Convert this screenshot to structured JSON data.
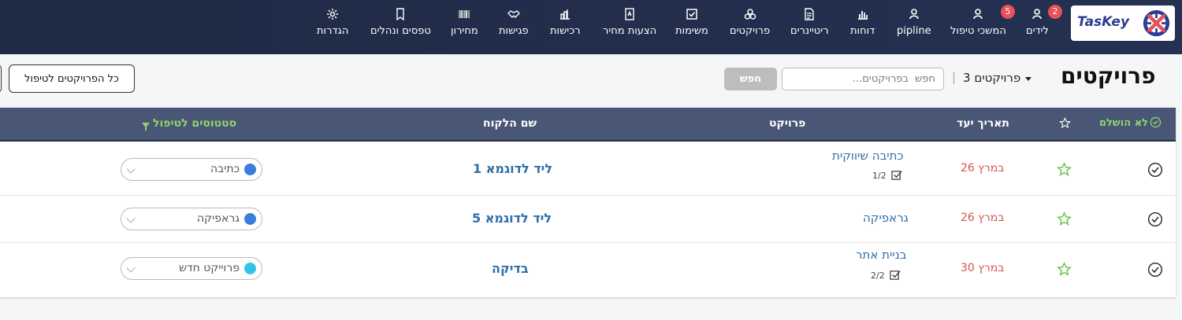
{
  "brand": {
    "name": "TasKey"
  },
  "colors": {
    "nav_bg": "#1f2a44",
    "header_bg": "#4a5675",
    "link": "#2f6ea8",
    "date": "#d9534f",
    "green": "#8fd46b"
  },
  "nav": {
    "items": [
      {
        "label": "לידים",
        "icon": "person-icon",
        "badge": "2"
      },
      {
        "label": "המשכי טיפול",
        "icon": "person-icon",
        "badge": "5"
      },
      {
        "label": "pipline",
        "icon": "person-icon"
      },
      {
        "label": "דוחות",
        "icon": "bar-chart-icon"
      },
      {
        "label": "ריטיינרים",
        "icon": "invoice-icon"
      },
      {
        "label": "פרויקטים",
        "icon": "cubes-icon"
      },
      {
        "label": "משימות",
        "icon": "check-square-icon"
      },
      {
        "label": "הצעות מחיר",
        "icon": "quote-icon"
      },
      {
        "label": "רכישות",
        "icon": "purchase-icon"
      },
      {
        "label": "פגישות",
        "icon": "handshake-icon"
      },
      {
        "label": "מחירון",
        "icon": "barcode-icon"
      },
      {
        "label": "טפסים ונהלים",
        "icon": "form-icon"
      },
      {
        "label": "הגדרות",
        "icon": "gear-icon"
      }
    ]
  },
  "header": {
    "title": "פרויקטים",
    "project_count": "3 פרויקטים",
    "search_placeholder": "חפש  בפרויקטים...",
    "search_button": "חפש",
    "all_projects_button": "כל הפרויקטים לטיפול"
  },
  "table": {
    "columns": {
      "incomplete": "לא הושלם",
      "due_date": "תאריך יעד",
      "project": "פרויקט",
      "client": "שם הלקוח",
      "statuses": "סטטוסים לטיפול"
    },
    "rows": [
      {
        "due_date": "26 במרץ",
        "project": "כתיבה שיווקית",
        "tasks": "1/2",
        "client": "ליד לדוגמא 1",
        "status": "כתיבה",
        "status_color": "#3b7ddd"
      },
      {
        "due_date": "26 במרץ",
        "project": "גראפיקה",
        "tasks": "",
        "client": "ליד לדוגמא 5",
        "status": "גראפיקה",
        "status_color": "#3b7ddd"
      },
      {
        "due_date": "30 במרץ",
        "project": "בניית אתר",
        "tasks": "2/2",
        "client": "בדיקה",
        "status": "פרוייקט חדש",
        "status_color": "#33c3e8"
      }
    ]
  }
}
